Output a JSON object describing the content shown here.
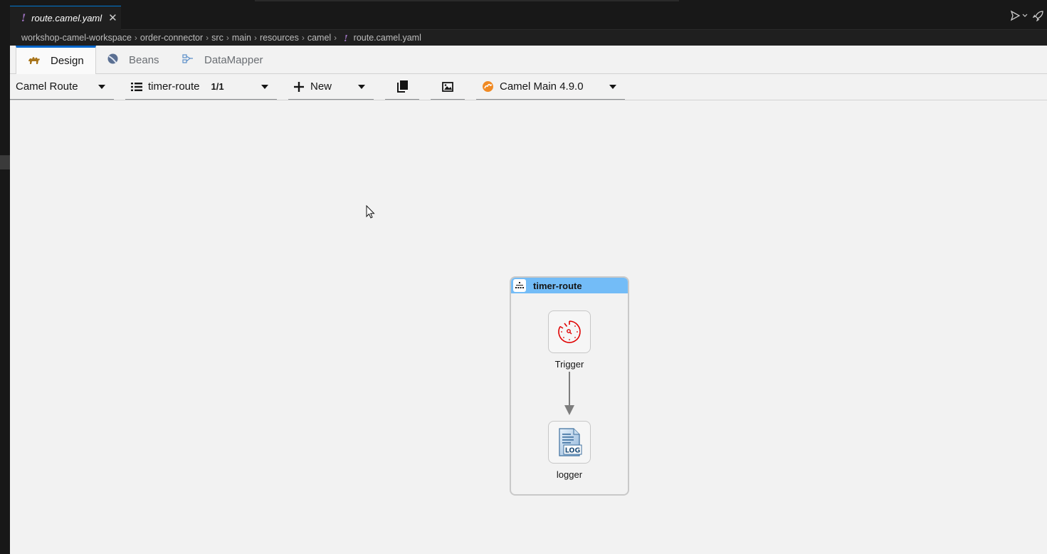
{
  "editor_tab": {
    "filename": "route.camel.yaml",
    "close_glyph": "✕"
  },
  "breadcrumb": {
    "segments": [
      "workshop-camel-workspace",
      "order-connector",
      "src",
      "main",
      "resources",
      "camel"
    ],
    "file": "route.camel.yaml"
  },
  "subtabs": [
    {
      "label": "Design",
      "icon": "camel-icon",
      "active": true
    },
    {
      "label": "Beans",
      "icon": "beans-icon",
      "active": false
    },
    {
      "label": "DataMapper",
      "icon": "datamapper-icon",
      "active": false
    }
  ],
  "toolbar": {
    "type_select": "Camel Route",
    "route_select": "timer-route",
    "route_count": "1/1",
    "new_label": "New",
    "runtime_select": "Camel Main 4.9.0"
  },
  "route": {
    "title": "timer-route",
    "nodes": [
      {
        "label": "Trigger",
        "icon": "timer-icon"
      },
      {
        "label": "logger",
        "icon": "log-icon"
      }
    ]
  },
  "colors": {
    "accent": "#0066cc",
    "route_header": "#73bcf7",
    "timer_red": "#e00000",
    "yaml_purple": "#a074c4"
  }
}
